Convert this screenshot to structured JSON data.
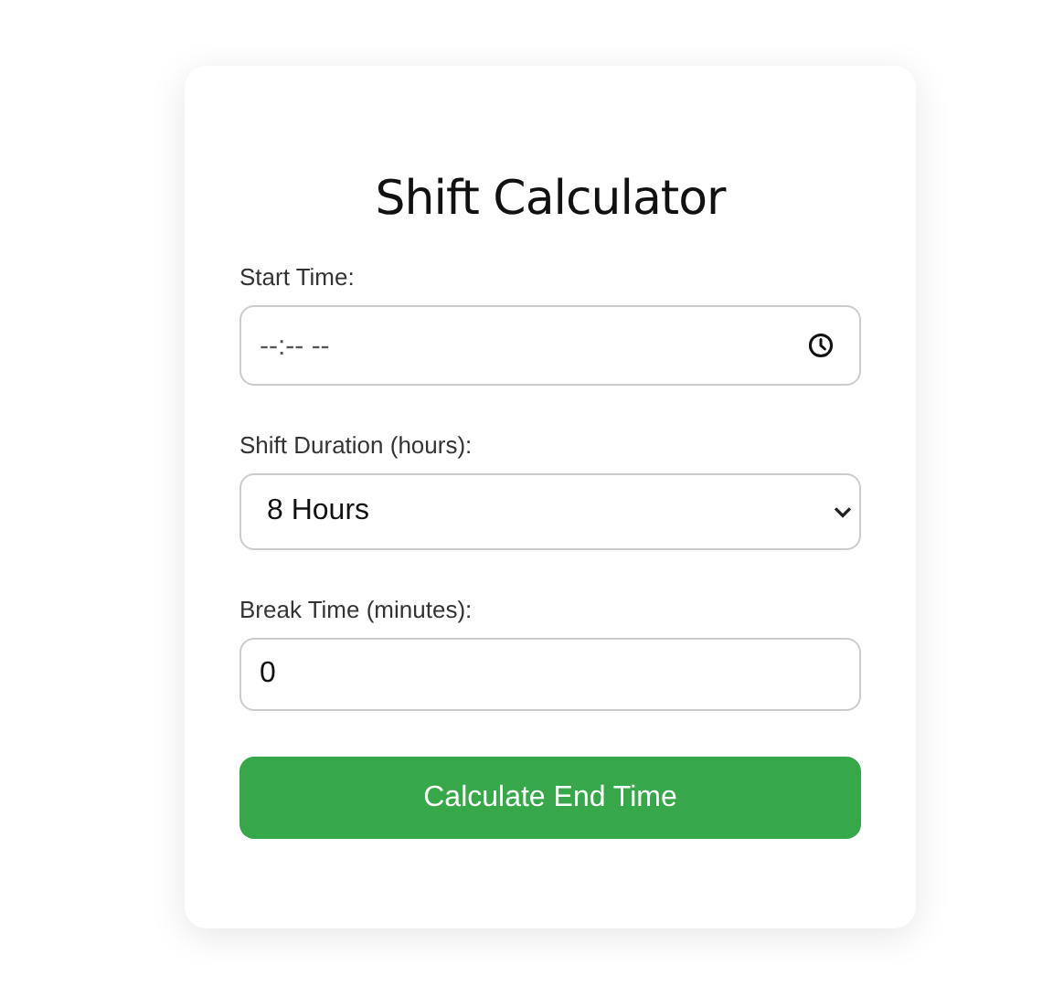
{
  "title": "Shift Calculator",
  "fields": [
    {
      "kind": "time",
      "label": "Start Time:",
      "placeholder": "--:-- --"
    },
    {
      "kind": "select",
      "label": "Shift Duration (hours):",
      "value": "8 Hours"
    },
    {
      "kind": "number",
      "label": "Break Time (minutes):",
      "value": "0"
    }
  ],
  "button": "Calculate End Time"
}
